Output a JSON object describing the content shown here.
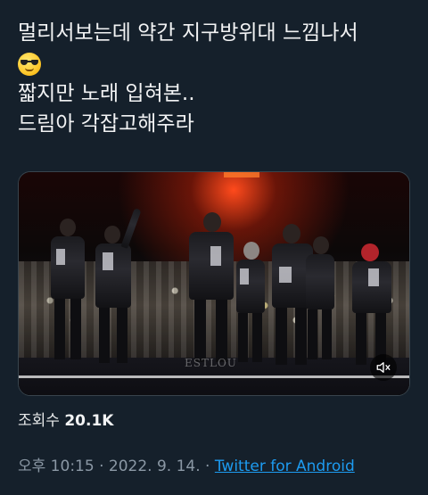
{
  "tweet": {
    "lines": [
      "멀리서보는데 약간 지구방위대 느낌나서",
      "짧지만 노래 입혀본..",
      "드림아 각잡고해주라"
    ],
    "emoji": "smiling-face-with-sunglasses"
  },
  "media": {
    "watermark": "ESTLOU",
    "mute_icon": "speaker-muted-icon"
  },
  "stats": {
    "views_label": "조회수",
    "views_count": "20.1K"
  },
  "meta": {
    "time": "오후 10:15",
    "separator": "·",
    "date": "2022. 9. 14.",
    "source": "Twitter for Android"
  },
  "colors": {
    "background": "#15202b",
    "text": "#e7e9ea",
    "muted": "#8b98a5",
    "link": "#1d9bf0"
  }
}
